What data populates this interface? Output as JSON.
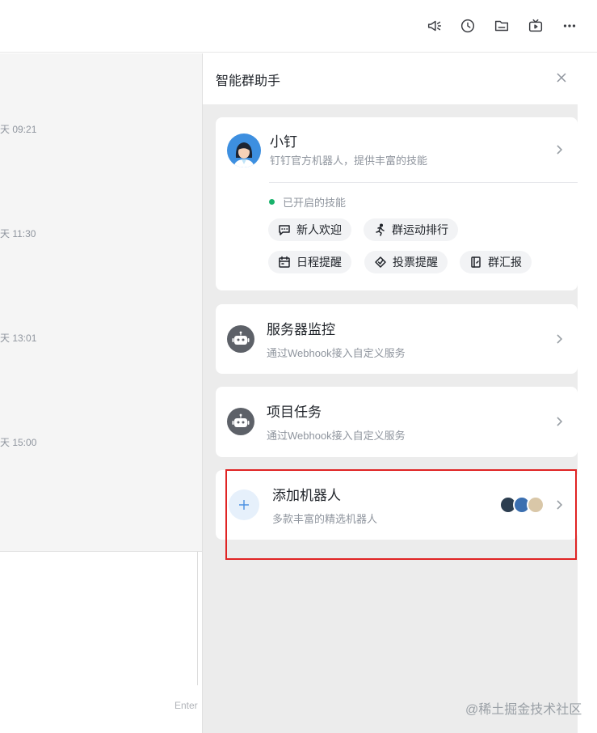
{
  "toolbar": {
    "icons": [
      "announcement-icon",
      "history-icon",
      "folder-icon",
      "live-icon",
      "more-icon"
    ]
  },
  "chat": {
    "times": [
      "天 09:21",
      "天 11:30",
      "天 13:01",
      "天 15:00"
    ],
    "enter_hint": "Enter"
  },
  "panel": {
    "title": "智能群助手",
    "cards": {
      "xiaoding": {
        "name": "小钉",
        "desc": "钉钉官方机器人，提供丰富的技能",
        "skills_label": "已开启的技能",
        "skills": [
          "新人欢迎",
          "群运动排行",
          "日程提醒",
          "投票提醒",
          "群汇报"
        ]
      },
      "server_monitor": {
        "name": "服务器监控",
        "desc": "通过Webhook接入自定义服务"
      },
      "project_task": {
        "name": "项目任务",
        "desc": "通过Webhook接入自定义服务"
      },
      "add_robot": {
        "name": "添加机器人",
        "desc": "多款丰富的精选机器人"
      }
    }
  },
  "colors": {
    "highlight_border": "#e02424",
    "status_dot": "#19b26b",
    "panel_bg": "#ececec"
  },
  "watermark": "@稀土掘金技术社区"
}
